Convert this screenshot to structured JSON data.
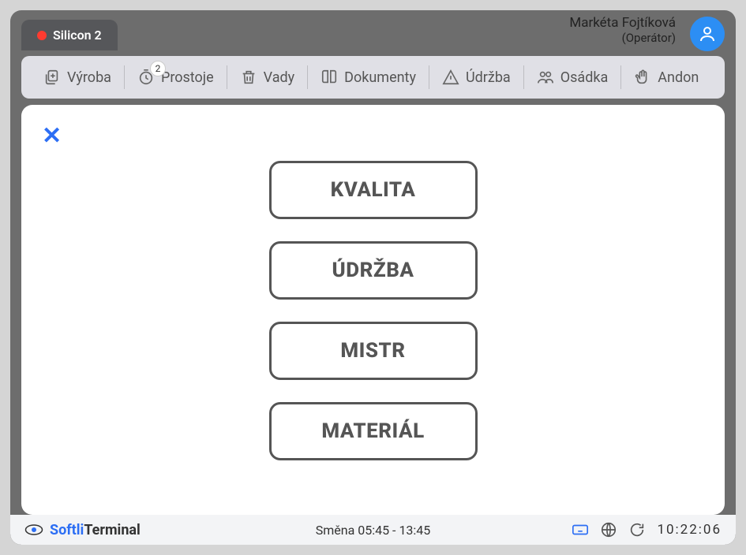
{
  "header": {
    "tab_label": "Silicon 2",
    "user_name": "Markéta Fojtíková",
    "user_role": "(Operátor)"
  },
  "toolbar": {
    "items": [
      {
        "label": "Výroba",
        "icon": "copy-plus-icon",
        "badge": null
      },
      {
        "label": "Prostoje",
        "icon": "clock-stop-icon",
        "badge": "2"
      },
      {
        "label": "Vady",
        "icon": "trash-icon",
        "badge": null
      },
      {
        "label": "Dokumenty",
        "icon": "book-icon",
        "badge": null
      },
      {
        "label": "Údržba",
        "icon": "warning-icon",
        "badge": null
      },
      {
        "label": "Osádka",
        "icon": "people-icon",
        "badge": null
      },
      {
        "label": "Andon",
        "icon": "hand-icon",
        "badge": null
      }
    ]
  },
  "andon": {
    "buttons": [
      {
        "label": "KVALITA"
      },
      {
        "label": "ÚDRŽBA"
      },
      {
        "label": "MISTR"
      },
      {
        "label": "MATERIÁL"
      }
    ]
  },
  "footer": {
    "brand_prefix": "Softli",
    "brand_suffix": "Terminal",
    "shift_text": "Směna 05:45 - 13:45",
    "clock": "10:22:06"
  }
}
